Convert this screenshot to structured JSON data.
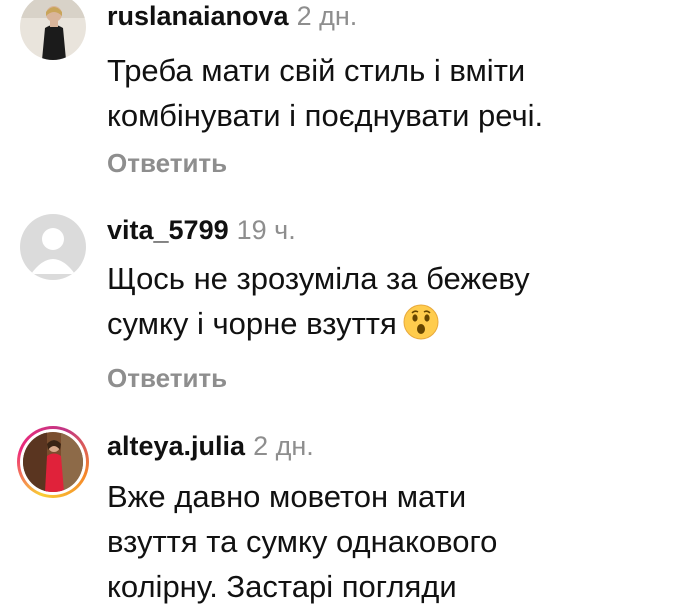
{
  "comments": [
    {
      "username": "ruslanaianova",
      "time": "2 дн.",
      "lines": [
        "Треба  мати свій стиль і вміти",
        "комбінувати і поєднувати  речі."
      ],
      "reply_label": "Ответить",
      "avatar": "photo-avatar"
    },
    {
      "username": "vita_5799",
      "time": "19 ч.",
      "lines": [
        "Щось не зрозуміла за бежеву",
        "сумку і чорне взуття"
      ],
      "emoji": "surprised-face",
      "reply_label": "Ответить",
      "avatar": "default-person-avatar"
    },
    {
      "username": "alteya.julia",
      "time": "2 дн.",
      "lines": [
        "Вже давно моветон мати",
        "взуття та сумку однакового",
        "колірну. Застарі погляди"
      ],
      "avatar": "story-ring-photo-avatar"
    }
  ],
  "colors": {
    "text": "#111111",
    "muted": "#8e8e8e",
    "default_avatar_bg": "#dbdbdb",
    "story_ring": [
      "#f9ce34",
      "#ee2a7b",
      "#c13584",
      "#f58529"
    ]
  }
}
